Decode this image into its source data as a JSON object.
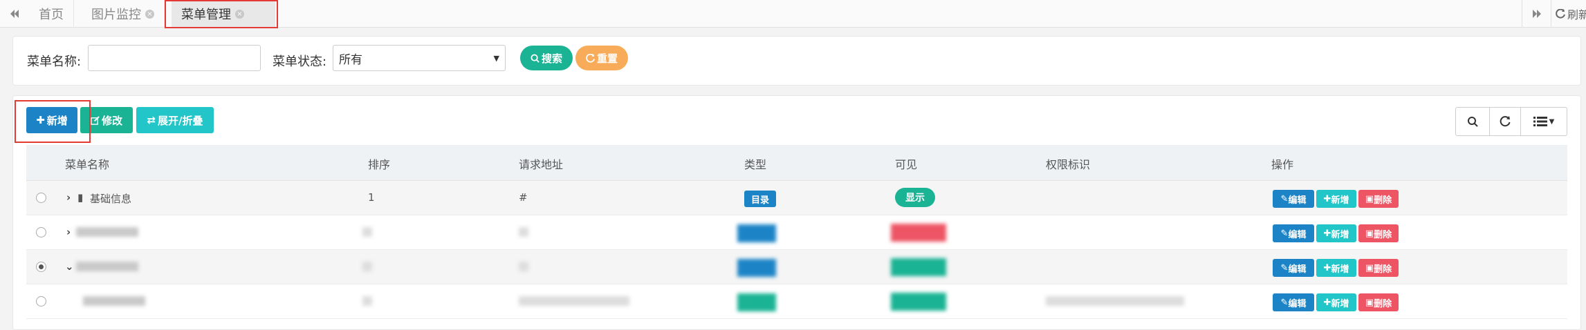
{
  "tabbar": {
    "prev_icon": "double-chevron-left-icon",
    "tabs": [
      {
        "label": "首页",
        "closable": false
      },
      {
        "label": "图片监控",
        "closable": true
      },
      {
        "label": "菜单管理",
        "closable": true,
        "active": true
      }
    ],
    "next_icon": "double-chevron-right-icon",
    "refresh_label": "刷新"
  },
  "search": {
    "name_label": "菜单名称:",
    "name_value": "",
    "status_label": "菜单状态:",
    "status_value": "所有",
    "search_button": "搜索",
    "reset_button": "重置"
  },
  "toolbar": {
    "add_label": "新增",
    "edit_label": "修改",
    "toggle_label": "展开/折叠"
  },
  "table": {
    "columns": [
      "菜单名称",
      "排序",
      "请求地址",
      "类型",
      "可见",
      "权限标识",
      "操作"
    ],
    "rows": [
      {
        "name": "基础信息",
        "order": "1",
        "url": "#",
        "type": "目录",
        "visible": "显示",
        "perms": "",
        "checked": false
      }
    ],
    "actions": {
      "edit": "编辑",
      "add": "新增",
      "delete": "删除"
    }
  },
  "colors": {
    "primary": "#1c84c6",
    "success": "#1ab394",
    "info": "#23c6c8",
    "warning": "#f8ac59",
    "danger": "#ed5565",
    "highlight": "#e53935"
  }
}
